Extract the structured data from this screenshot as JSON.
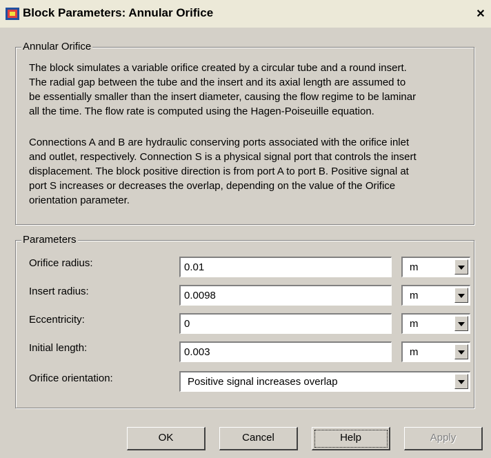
{
  "window": {
    "title": "Block Parameters: Annular Orifice",
    "close_glyph": "✕"
  },
  "description": {
    "group_title": "Annular Orifice",
    "paragraph1": "The block simulates a variable orifice created by a circular tube and a round insert.\nThe radial gap between the tube and the insert and its axial length are assumed to\nbe essentially smaller than the insert diameter, causing the flow regime to be laminar\nall the time. The flow rate is computed using the Hagen-Poiseuille equation.",
    "paragraph2": "Connections A and B are hydraulic conserving ports associated with the orifice inlet\nand outlet, respectively. Connection S is a physical signal port that controls the insert\ndisplacement. The block positive direction is from port A to port B. Positive signal at\nport S increases or decreases the overlap, depending on the value of the Orifice\norientation parameter."
  },
  "parameters": {
    "group_title": "Parameters",
    "rows": [
      {
        "label": "Orifice radius:",
        "value": "0.01",
        "unit": "m"
      },
      {
        "label": "Insert radius:",
        "value": "0.0098",
        "unit": "m"
      },
      {
        "label": "Eccentricity:",
        "value": "0",
        "unit": "m"
      },
      {
        "label": "Initial length:",
        "value": "0.003",
        "unit": "m"
      }
    ],
    "orientation": {
      "label": "Orifice orientation:",
      "value": "Positive signal increases overlap"
    }
  },
  "buttons": {
    "ok": "OK",
    "cancel": "Cancel",
    "help": "Help",
    "apply": "Apply"
  },
  "icons": {
    "app": "simulink-block-icon",
    "close": "close-icon",
    "dropdown": "chevron-down-icon"
  }
}
